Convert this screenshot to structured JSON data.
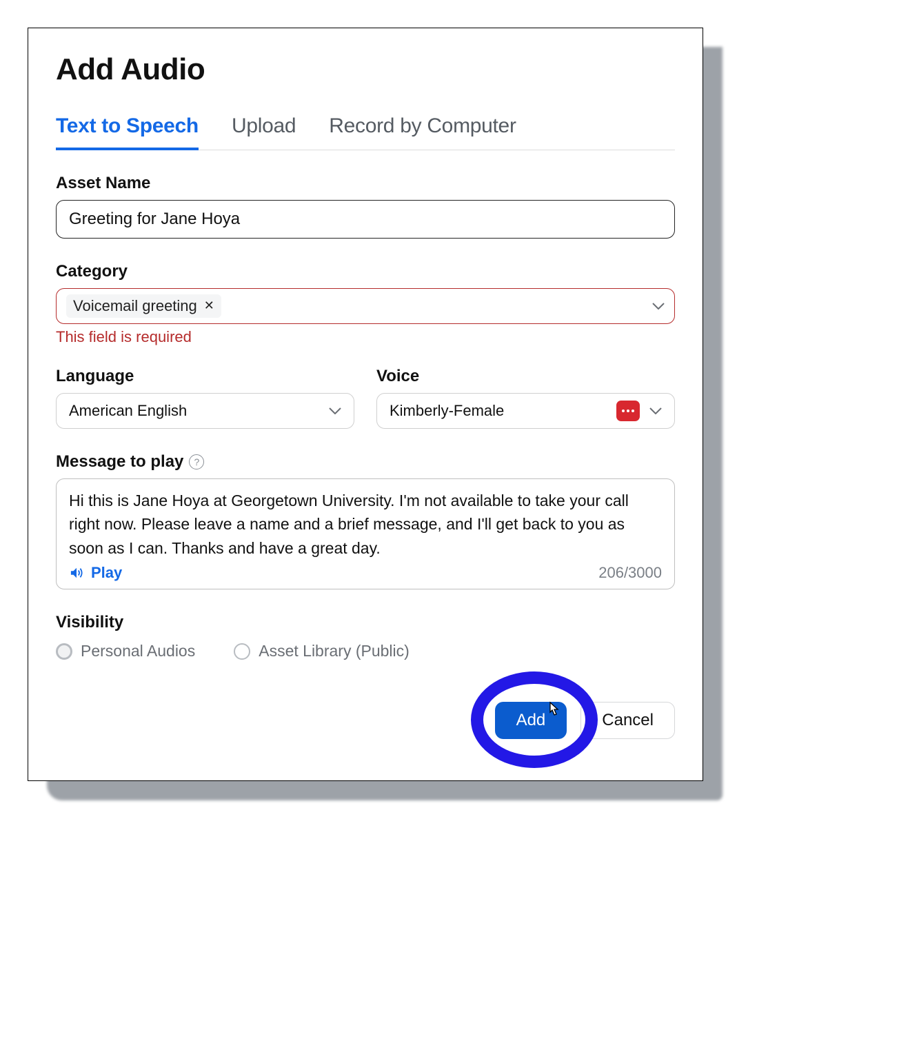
{
  "title": "Add Audio",
  "tabs": [
    {
      "label": "Text to Speech",
      "active": true
    },
    {
      "label": "Upload",
      "active": false
    },
    {
      "label": "Record by Computer",
      "active": false
    }
  ],
  "asset_name": {
    "label": "Asset Name",
    "value": "Greeting for Jane Hoya"
  },
  "category": {
    "label": "Category",
    "chip": "Voicemail greeting",
    "error": "This field is required"
  },
  "language": {
    "label": "Language",
    "value": "American English"
  },
  "voice": {
    "label": "Voice",
    "value": "Kimberly-Female"
  },
  "message": {
    "label": "Message to play",
    "value": "Hi this is Jane Hoya at Georgetown University. I'm not available to take your call right now. Please leave a name and a brief message, and I'll get back to you as soon as I can. Thanks and have a great day.",
    "play_label": "Play",
    "counter": "206/3000"
  },
  "visibility": {
    "label": "Visibility",
    "options": [
      {
        "label": "Personal Audios",
        "selected": true
      },
      {
        "label": "Asset Library (Public)",
        "selected": false
      }
    ]
  },
  "actions": {
    "add": "Add",
    "cancel": "Cancel"
  }
}
